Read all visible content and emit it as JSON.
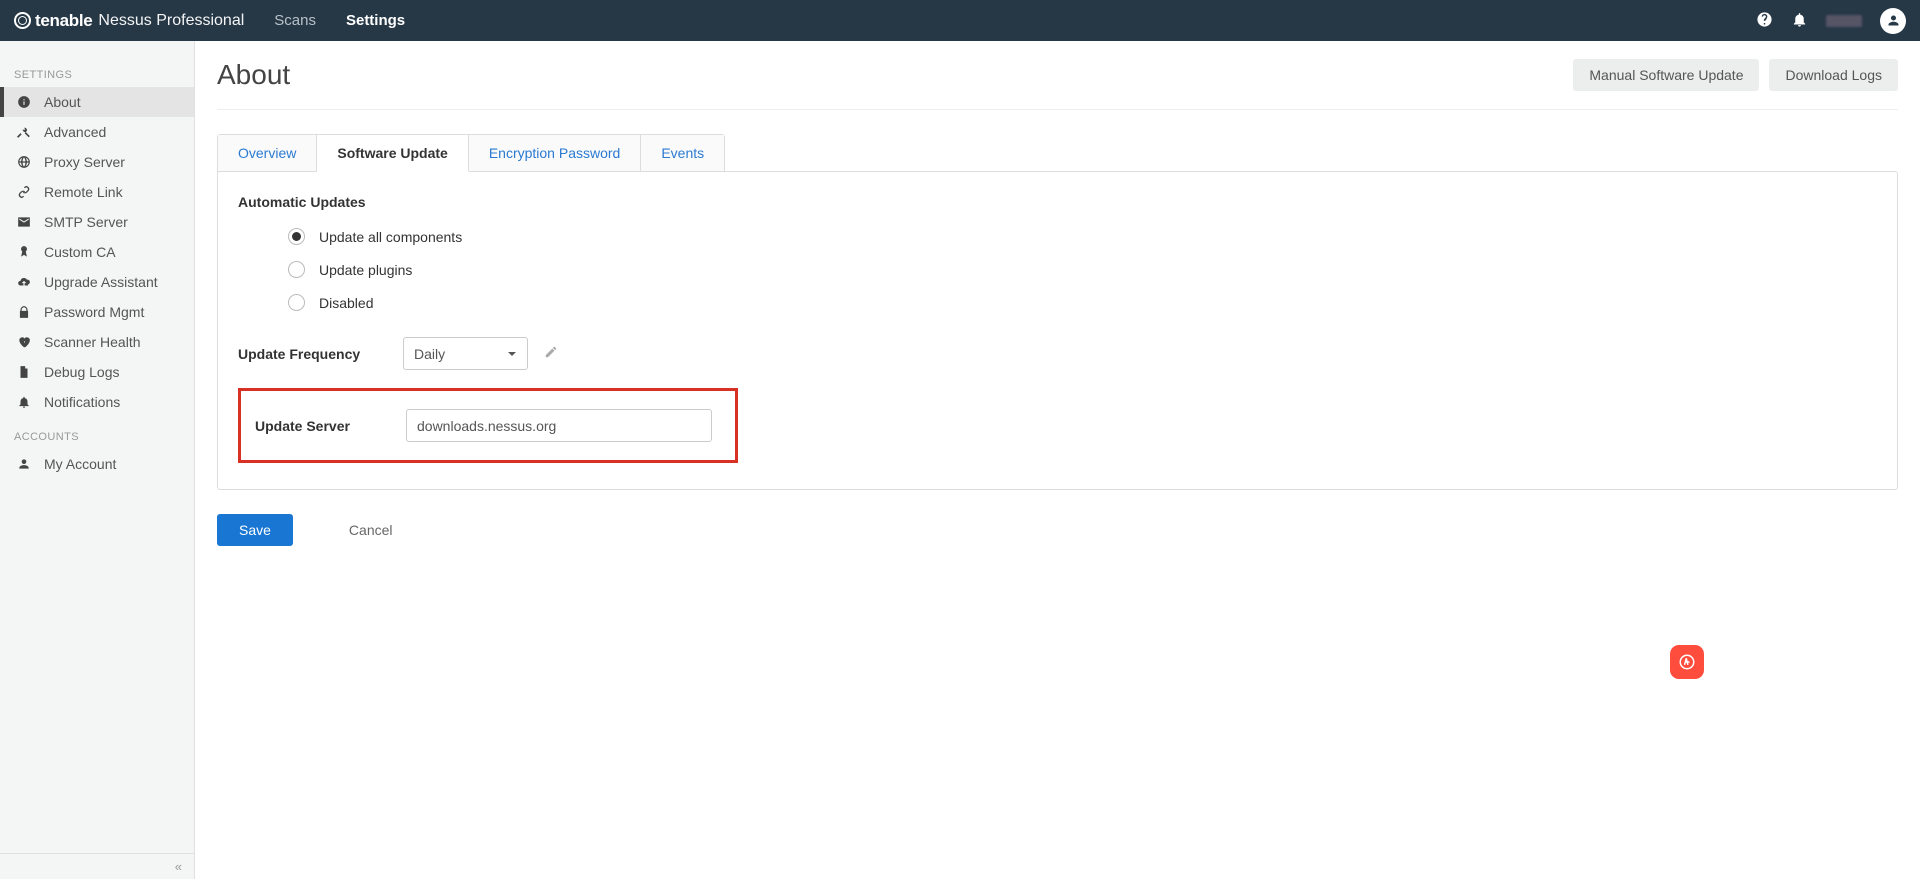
{
  "brand": {
    "vendor": "tenable",
    "product": "Nessus Professional"
  },
  "topnav": {
    "scans": "Scans",
    "settings": "Settings"
  },
  "sidebar": {
    "section_settings": "SETTINGS",
    "section_accounts": "ACCOUNTS",
    "items": {
      "about": "About",
      "advanced": "Advanced",
      "proxy": "Proxy Server",
      "remote": "Remote Link",
      "smtp": "SMTP Server",
      "customca": "Custom CA",
      "upgrade": "Upgrade Assistant",
      "password": "Password Mgmt",
      "health": "Scanner Health",
      "debug": "Debug Logs",
      "notifications": "Notifications",
      "myaccount": "My Account"
    }
  },
  "page": {
    "title": "About"
  },
  "actions": {
    "manual_update": "Manual Software Update",
    "download_logs": "Download Logs"
  },
  "tabs": {
    "overview": "Overview",
    "software_update": "Software Update",
    "encryption": "Encryption Password",
    "events": "Events"
  },
  "form": {
    "auto_updates_title": "Automatic Updates",
    "radio_all": "Update all components",
    "radio_plugins": "Update plugins",
    "radio_disabled": "Disabled",
    "frequency_label": "Update Frequency",
    "frequency_value": "Daily",
    "server_label": "Update Server",
    "server_value": "downloads.nessus.org",
    "save": "Save",
    "cancel": "Cancel"
  }
}
